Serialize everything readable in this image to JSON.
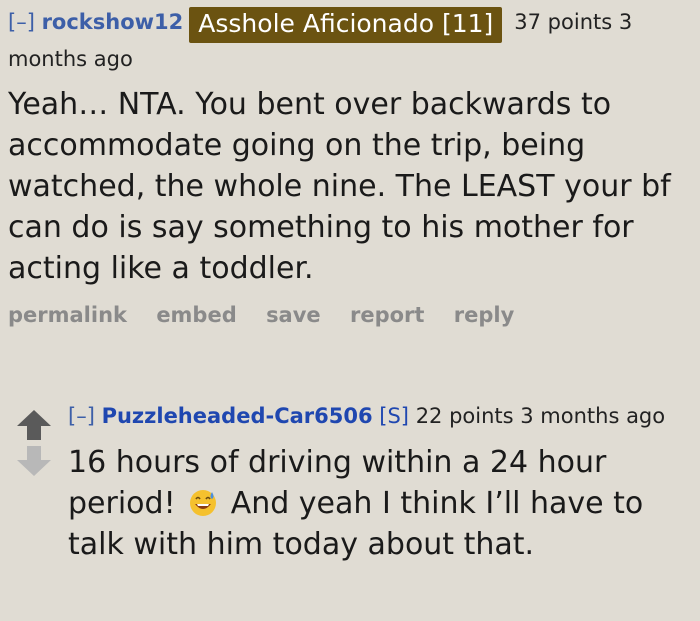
{
  "comment1": {
    "toggle": "[–]",
    "author": "rockshow12",
    "flair": "Asshole Aficionado [11]",
    "meta": "37 points 3 months ago",
    "body": "Yeah… NTA. You bent over backwards to accommodate going on the trip, being watched, the whole nine. The LEAST your bf can do is say something to his mother for acting like a toddler.",
    "buttons": [
      "permalink",
      "embed",
      "save",
      "report",
      "reply"
    ]
  },
  "comment2": {
    "toggle": "[–]",
    "author": "Puzzleheaded-Car6506",
    "submitter": "[S]",
    "meta": "22 points 3 months ago",
    "body_before_emoji": "16 hours of driving within a 24 hour period!",
    "emoji": "grinning-sweat-emoji",
    "body_after_emoji": "And yeah I think I’ll have to talk with him today about that."
  },
  "icons": {
    "upvote": "upvote-arrow-icon",
    "downvote": "downvote-arrow-icon"
  },
  "colors": {
    "background": "#e0dcd3",
    "flair_bg": "#6b5311",
    "link": "#3d5fa8",
    "author2": "#1f47b0"
  }
}
